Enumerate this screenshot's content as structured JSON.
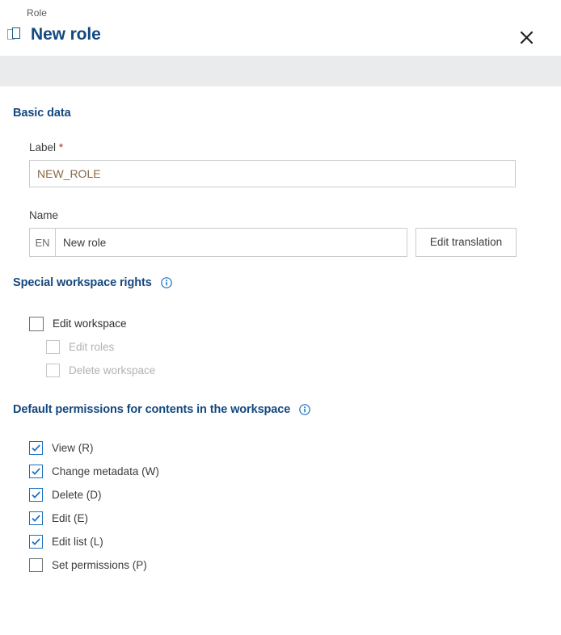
{
  "header": {
    "breadcrumb": "Role",
    "title": "New role",
    "title_icon": "copy-pages-icon",
    "close_icon": "close-icon",
    "close_label": "Close"
  },
  "colors": {
    "accent": "#14487f",
    "link": "#1a6ec0",
    "band": "#eaebec",
    "required": "#9b3a2d",
    "input_value": "#8a6a44",
    "disabled": "#b0b2b4"
  },
  "sections": {
    "basic": {
      "heading": "Basic data",
      "label_field": {
        "label": "Label",
        "required_marker": "*",
        "value": "NEW_ROLE",
        "placeholder": ""
      },
      "name_field": {
        "label": "Name",
        "lang_tag": "EN",
        "value": "New role",
        "placeholder": "",
        "button_label": "Edit translation"
      }
    },
    "special_rights": {
      "heading": "Special workspace rights",
      "info_icon": "info-icon",
      "items": [
        {
          "label": "Edit workspace",
          "checked": false,
          "disabled": false,
          "indent": false
        },
        {
          "label": "Edit roles",
          "checked": false,
          "disabled": true,
          "indent": true
        },
        {
          "label": "Delete workspace",
          "checked": false,
          "disabled": true,
          "indent": true
        }
      ]
    },
    "default_permissions": {
      "heading": "Default permissions for contents in the workspace",
      "info_icon": "info-icon",
      "items": [
        {
          "label": "View (R)",
          "checked": true,
          "disabled": false,
          "indent": false
        },
        {
          "label": "Change metadata (W)",
          "checked": true,
          "disabled": false,
          "indent": false
        },
        {
          "label": "Delete (D)",
          "checked": true,
          "disabled": false,
          "indent": false
        },
        {
          "label": "Edit (E)",
          "checked": true,
          "disabled": false,
          "indent": false
        },
        {
          "label": "Edit list (L)",
          "checked": true,
          "disabled": false,
          "indent": false
        },
        {
          "label": "Set permissions (P)",
          "checked": false,
          "disabled": false,
          "indent": false
        }
      ]
    }
  }
}
